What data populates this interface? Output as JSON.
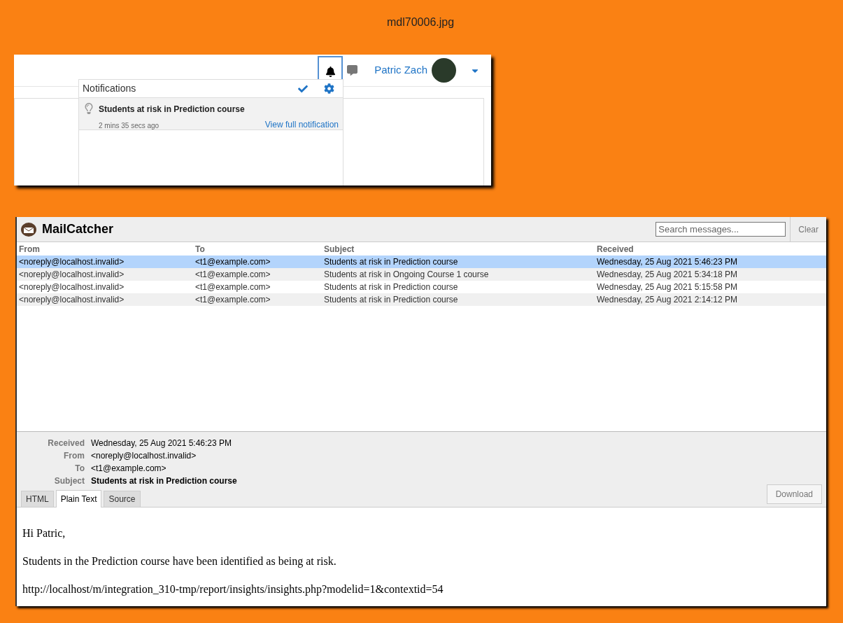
{
  "caption": "mdl70006.jpg",
  "moodle": {
    "user_name": "Patric Zach",
    "notifications": {
      "title": "Notifications",
      "items": [
        {
          "title": "Students at risk in Prediction course",
          "time": "2 mins 35 secs ago",
          "link": "View full notification"
        }
      ]
    }
  },
  "mailcatcher": {
    "title": "MailCatcher",
    "search": {
      "placeholder": "Search messages..."
    },
    "clear_button": "Clear",
    "columns": [
      "From",
      "To",
      "Subject",
      "Received"
    ],
    "rows": [
      {
        "cells": [
          "<noreply@localhost.invalid>",
          "<t1@example.com>",
          "Students at risk in Prediction course",
          "Wednesday, 25 Aug 2021 5:46:23 PM"
        ],
        "selected": true
      },
      {
        "cells": [
          "<noreply@localhost.invalid>",
          "<t1@example.com>",
          "Students at risk in Ongoing Course 1 course",
          "Wednesday, 25 Aug 2021 5:34:18 PM"
        ],
        "selected": false
      },
      {
        "cells": [
          "<noreply@localhost.invalid>",
          "<t1@example.com>",
          "Students at risk in Prediction course",
          "Wednesday, 25 Aug 2021 5:15:58 PM"
        ],
        "selected": false
      },
      {
        "cells": [
          "<noreply@localhost.invalid>",
          "<t1@example.com>",
          "Students at risk in Prediction course",
          "Wednesday, 25 Aug 2021 2:14:12 PM"
        ],
        "selected": false
      }
    ],
    "headers": [
      {
        "label": "Received",
        "value": "Wednesday, 25 Aug 2021 5:46:23 PM",
        "bold": false
      },
      {
        "label": "From",
        "value": "<noreply@localhost.invalid>",
        "bold": false
      },
      {
        "label": "To",
        "value": "<t1@example.com>",
        "bold": false
      },
      {
        "label": "Subject",
        "value": "Students at risk in Prediction course",
        "bold": true
      }
    ],
    "tabs": [
      {
        "label": "HTML",
        "selected": false
      },
      {
        "label": "Plain Text",
        "selected": true
      },
      {
        "label": "Source",
        "selected": false
      }
    ],
    "download_button": "Download",
    "body": [
      "Hi Patric,",
      "Students in the Prediction course have been identified as being at risk.",
      "http://localhost/m/integration_310-tmp/report/insights/insights.php?modelid=1&contextid=54"
    ]
  }
}
